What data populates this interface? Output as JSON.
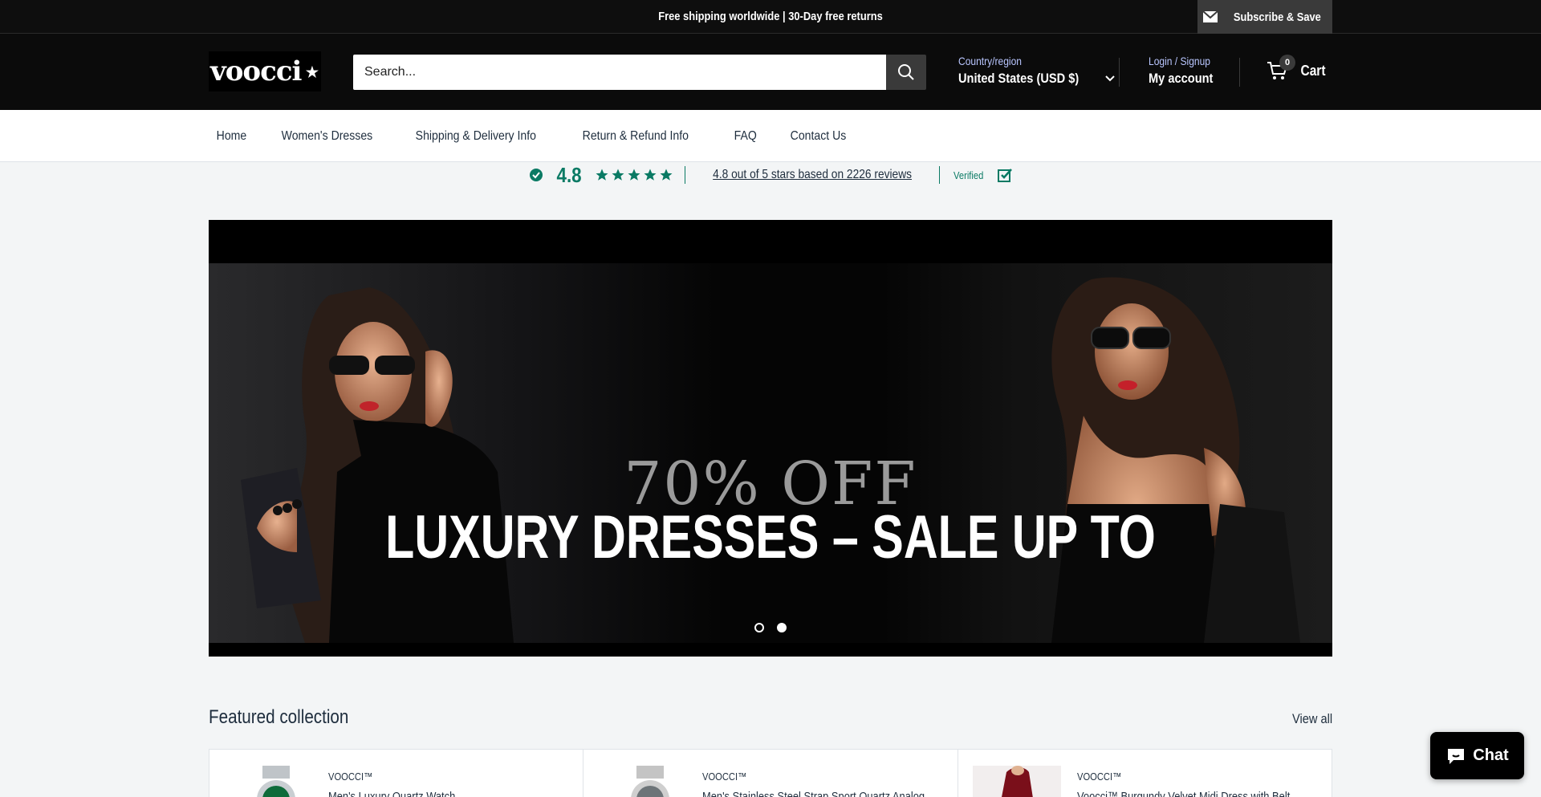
{
  "announcement": {
    "text": "Free shipping worldwide | 30-Day free returns",
    "subscribe_label": "Subscribe & Save"
  },
  "header": {
    "logo_text": "voocci",
    "search_placeholder": "Search...",
    "country_label": "Country/region",
    "country_value": "United States (USD $)",
    "login_label": "Login / Signup",
    "account_label": "My account",
    "cart_count": "0",
    "cart_label": "Cart"
  },
  "nav": {
    "items": [
      {
        "label": "Home"
      },
      {
        "label": "Women's Dresses"
      },
      {
        "label": "Shipping & Delivery Info"
      },
      {
        "label": "Return & Refund Info"
      },
      {
        "label": "FAQ"
      },
      {
        "label": "Contact Us"
      }
    ]
  },
  "reviews": {
    "score": "4.8",
    "summary": "4.8 out of 5 stars based on 2226 reviews",
    "verified": "Verified",
    "star_count": 5
  },
  "hero": {
    "subtitle": "70% OFF",
    "title": "LUXURY DRESSES – SALE UP TO",
    "slide_count": 2,
    "active_slide": 2
  },
  "featured": {
    "title": "Featured collection",
    "view_all": "View all",
    "products": [
      {
        "brand": "VOOCCI™",
        "name": "Men's Luxury Quartz Watch"
      },
      {
        "brand": "VOOCCI™",
        "name": "Men's Stainless Steel Strap Sport Quartz Analog"
      },
      {
        "brand": "VOOCCI™",
        "name": "Voocci™ Burgundy Velvet Midi Dress with Belt"
      }
    ]
  },
  "chat": {
    "label": "Chat"
  },
  "colors": {
    "accent_green": "#0a7a64",
    "header_bg": "#0b0b0b",
    "link_blue": "#b9c6ff"
  }
}
